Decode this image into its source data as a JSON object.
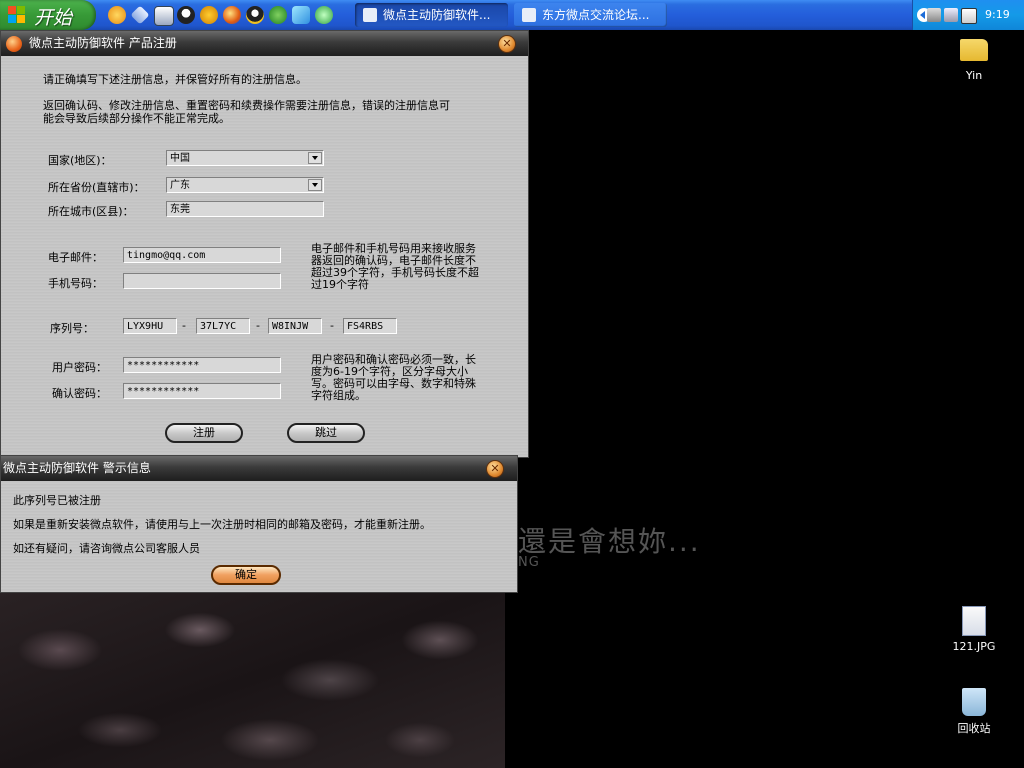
{
  "taskbar": {
    "start_label": "开始",
    "windows": [
      {
        "label": "微点主动防御软件..."
      },
      {
        "label": "东方微点交流论坛..."
      }
    ],
    "clock": "9:19"
  },
  "desktop": {
    "icons": [
      {
        "label": "Yin"
      },
      {
        "label": "121.JPG"
      },
      {
        "label": "回收站"
      }
    ],
    "wallpaper_text": "還是會想妳...",
    "wallpaper_subtext": "NG"
  },
  "main_window": {
    "title": "微点主动防御软件  产品注册",
    "intro_line1": "请正确填写下述注册信息，并保管好所有的注册信息。",
    "intro_line2": "返回确认码、修改注册信息、重置密码和续费操作需要注册信息，错误的注册信息可",
    "intro_line3": "能会导致后续部分操作不能正常完成。",
    "country_label": "国家(地区)：",
    "country_value": "中国",
    "province_label": "所在省份(直辖市)：",
    "province_value": "广东",
    "city_label": "所在城市(区县)：",
    "city_value": "东莞",
    "email_label": "电子邮件：",
    "email_value": "tingmo@qq.com",
    "phone_label": "手机号码：",
    "phone_value": "",
    "contact_note_lines": [
      "电子邮件和手机号码用来接收服务",
      "器返回的确认码，电子邮件长度不",
      "超过39个字符，手机号码长度不超",
      "过19个字符"
    ],
    "serial_label": "序列号：",
    "serial_parts": [
      "LYX9HU",
      "37L7YC",
      "W8INJW",
      "FS4RBS"
    ],
    "serial_sep": "-",
    "password_label": "用户密码：",
    "password_value": "************",
    "confirm_label": "确认密码：",
    "confirm_value": "************",
    "password_note_lines": [
      "用户密码和确认密码必须一致，长",
      "度为6-19个字符，区分字母大小",
      "写。密码可以由字母、数字和特殊",
      "字符组成。"
    ],
    "register_button": "注册",
    "skip_button": "跳过"
  },
  "alert_window": {
    "title": "微点主动防御软件  警示信息",
    "line1": "此序列号已被注册",
    "line2": "如果是重新安装微点软件，请使用与上一次注册时相同的邮箱及密码，才能重新注册。",
    "line3": "如还有疑问，请咨询微点公司客服人员",
    "ok_button": "确定"
  },
  "colors": {
    "taskbar_blue": "#245edb",
    "start_green": "#379a37",
    "window_gray": "#c6c6c6",
    "titlebar_dark": "#2a2a2a"
  },
  "icons": [
    "start-logo-icon",
    "ie-icon",
    "show-desktop-icon",
    "media-icon",
    "qq-penguin-icon",
    "info-icon",
    "firefox-icon",
    "qq-icon",
    "flash-icon",
    "tray-headset-icon",
    "folder-icon",
    "image-file-icon",
    "recycle-bin-icon",
    "close-icon",
    "app-icon"
  ]
}
